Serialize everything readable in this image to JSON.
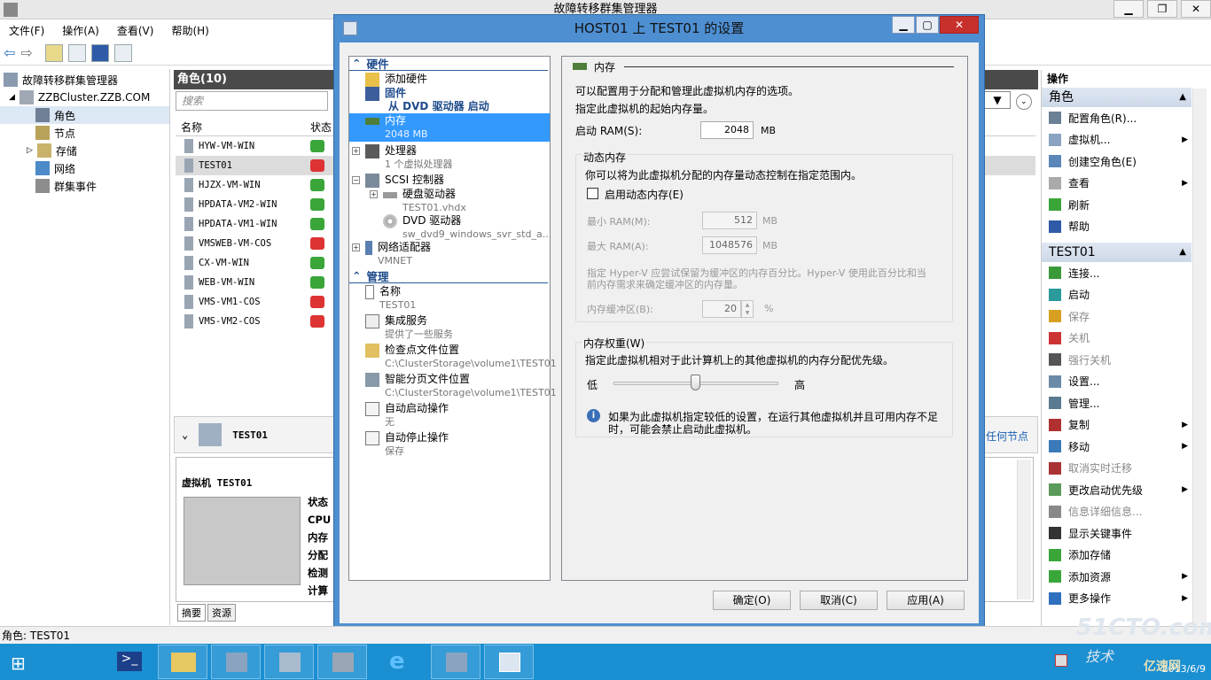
{
  "window": {
    "title": "故障转移群集管理器"
  },
  "menu": [
    "文件(F)",
    "操作(A)",
    "查看(V)",
    "帮助(H)"
  ],
  "tree": {
    "root": "故障转移群集管理器",
    "cluster": "ZZBCluster.ZZB.COM",
    "items": [
      "角色",
      "节点",
      "存储",
      "网络",
      "群集事件"
    ]
  },
  "center": {
    "header": "角色(10)",
    "search_placeholder": "搜索",
    "col_name": "名称",
    "col_status": "状态",
    "vms": [
      {
        "name": "HYW-VM-WIN",
        "status": "up"
      },
      {
        "name": "TEST01",
        "status": "down"
      },
      {
        "name": "HJZX-VM-WIN",
        "status": "up"
      },
      {
        "name": "HPDATA-VM2-WIN",
        "status": "up"
      },
      {
        "name": "HPDATA-VM1-WIN",
        "status": "up"
      },
      {
        "name": "VMSWEB-VM-COS",
        "status": "down"
      },
      {
        "name": "CX-VM-WIN",
        "status": "up"
      },
      {
        "name": "WEB-VM-WIN",
        "status": "up"
      },
      {
        "name": "VMS-VM1-COS",
        "status": "down"
      },
      {
        "name": "VMS-VM2-COS",
        "status": "down"
      }
    ],
    "detail_title": "TEST01",
    "detail_vm_label": "虚拟机 TEST01",
    "detail_fields": [
      "状态",
      "CPU",
      "内存",
      "分配",
      "检测",
      "计算"
    ],
    "right_link": "任何节点",
    "tabs": [
      "摘要",
      "资源"
    ]
  },
  "actions": {
    "header": "操作",
    "group_roles": "角色",
    "roles_items": [
      {
        "label": "配置角色(R)...",
        "arrow": false,
        "disabled": false
      },
      {
        "label": "虚拟机...",
        "arrow": true,
        "disabled": false
      },
      {
        "label": "创建空角色(E)",
        "arrow": false,
        "disabled": false
      },
      {
        "label": "查看",
        "arrow": true,
        "disabled": false
      },
      {
        "label": "刷新",
        "arrow": false,
        "disabled": false
      },
      {
        "label": "帮助",
        "arrow": false,
        "disabled": false
      }
    ],
    "group_vm": "TEST01",
    "vm_items": [
      {
        "label": "连接...",
        "arrow": false,
        "disabled": false
      },
      {
        "label": "启动",
        "arrow": false,
        "disabled": false
      },
      {
        "label": "保存",
        "arrow": false,
        "disabled": true
      },
      {
        "label": "关机",
        "arrow": false,
        "disabled": true
      },
      {
        "label": "强行关机",
        "arrow": false,
        "disabled": true
      },
      {
        "label": "设置...",
        "arrow": false,
        "disabled": false
      },
      {
        "label": "管理...",
        "arrow": false,
        "disabled": false
      },
      {
        "label": "复制",
        "arrow": true,
        "disabled": false
      },
      {
        "label": "移动",
        "arrow": true,
        "disabled": false
      },
      {
        "label": "取消实时迁移",
        "arrow": false,
        "disabled": true
      },
      {
        "label": "更改启动优先级",
        "arrow": true,
        "disabled": false
      },
      {
        "label": "信息详细信息...",
        "arrow": false,
        "disabled": true
      },
      {
        "label": "显示关键事件",
        "arrow": false,
        "disabled": false
      },
      {
        "label": "添加存储",
        "arrow": false,
        "disabled": false
      },
      {
        "label": "添加资源",
        "arrow": true,
        "disabled": false
      },
      {
        "label": "更多操作",
        "arrow": true,
        "disabled": false
      }
    ]
  },
  "status_bar": "角色: TEST01",
  "dialog": {
    "title": "HOST01 上 TEST01 的设置",
    "nav": {
      "hardware": "硬件",
      "add_hw": "添加硬件",
      "firmware": "固件",
      "firmware_sub": "从 DVD 驱动器 启动",
      "memory": "内存",
      "memory_sub": "2048 MB",
      "cpu": "处理器",
      "cpu_sub": "1 个虚拟处理器",
      "scsi": "SCSI 控制器",
      "hdd": "硬盘驱动器",
      "hdd_sub": "TEST01.vhdx",
      "dvd": "DVD 驱动器",
      "dvd_sub": "sw_dvd9_windows_svr_std_a...",
      "nic": "网络适配器",
      "nic_sub": "VMNET",
      "mgmt": "管理",
      "name": "名称",
      "name_sub": "TEST01",
      "integ": "集成服务",
      "integ_sub": "提供了一些服务",
      "ckpt": "检查点文件位置",
      "ckpt_sub": "C:\\ClusterStorage\\volume1\\TEST01",
      "paging": "智能分页文件位置",
      "paging_sub": "C:\\ClusterStorage\\volume1\\TEST01",
      "autostart": "自动启动操作",
      "autostart_sub": "无",
      "autostop": "自动停止操作",
      "autostop_sub": "保存"
    },
    "pane": {
      "section": "内存",
      "desc1": "可以配置用于分配和管理此虚拟机内存的选项。",
      "desc2": "指定此虚拟机的起始内存量。",
      "startup_label": "启动 RAM(S):",
      "startup_value": "2048",
      "unit_mb": "MB",
      "dyn_title": "动态内存",
      "dyn_desc": "你可以将为此虚拟机分配的内存量动态控制在指定范围内。",
      "dyn_checkbox": "启用动态内存(E)",
      "dyn_enabled": false,
      "min_label": "最小 RAM(M):",
      "min_value": "512",
      "max_label": "最大 RAM(A):",
      "max_value": "1048576",
      "buffer_desc1": "指定 Hyper-V 应尝试保留为缓冲区的内存百分比。Hyper-V 使用此百分比和当",
      "buffer_desc2": "前内存需求来确定缓冲区的内存量。",
      "buffer_label": "内存缓冲区(B):",
      "buffer_value": "20",
      "percent": "%",
      "weight_title": "内存权重(W)",
      "weight_desc": "指定此虚拟机相对于此计算机上的其他虚拟机的内存分配优先级。",
      "low": "低",
      "high": "高",
      "weight_level": 0.5,
      "info1": "如果为此虚拟机指定较低的设置，在运行其他虚拟机并且可用内存不足",
      "info2": "时，可能会禁止启动此虚拟机。"
    },
    "buttons": {
      "ok": "确定(O)",
      "cancel": "取消(C)",
      "apply": "应用(A)"
    }
  },
  "taskbar": {
    "clock_date": "2013/6/9"
  },
  "watermark": {
    "line1": "51CTO.com",
    "line2": "技术",
    "line3": "亿速网"
  }
}
